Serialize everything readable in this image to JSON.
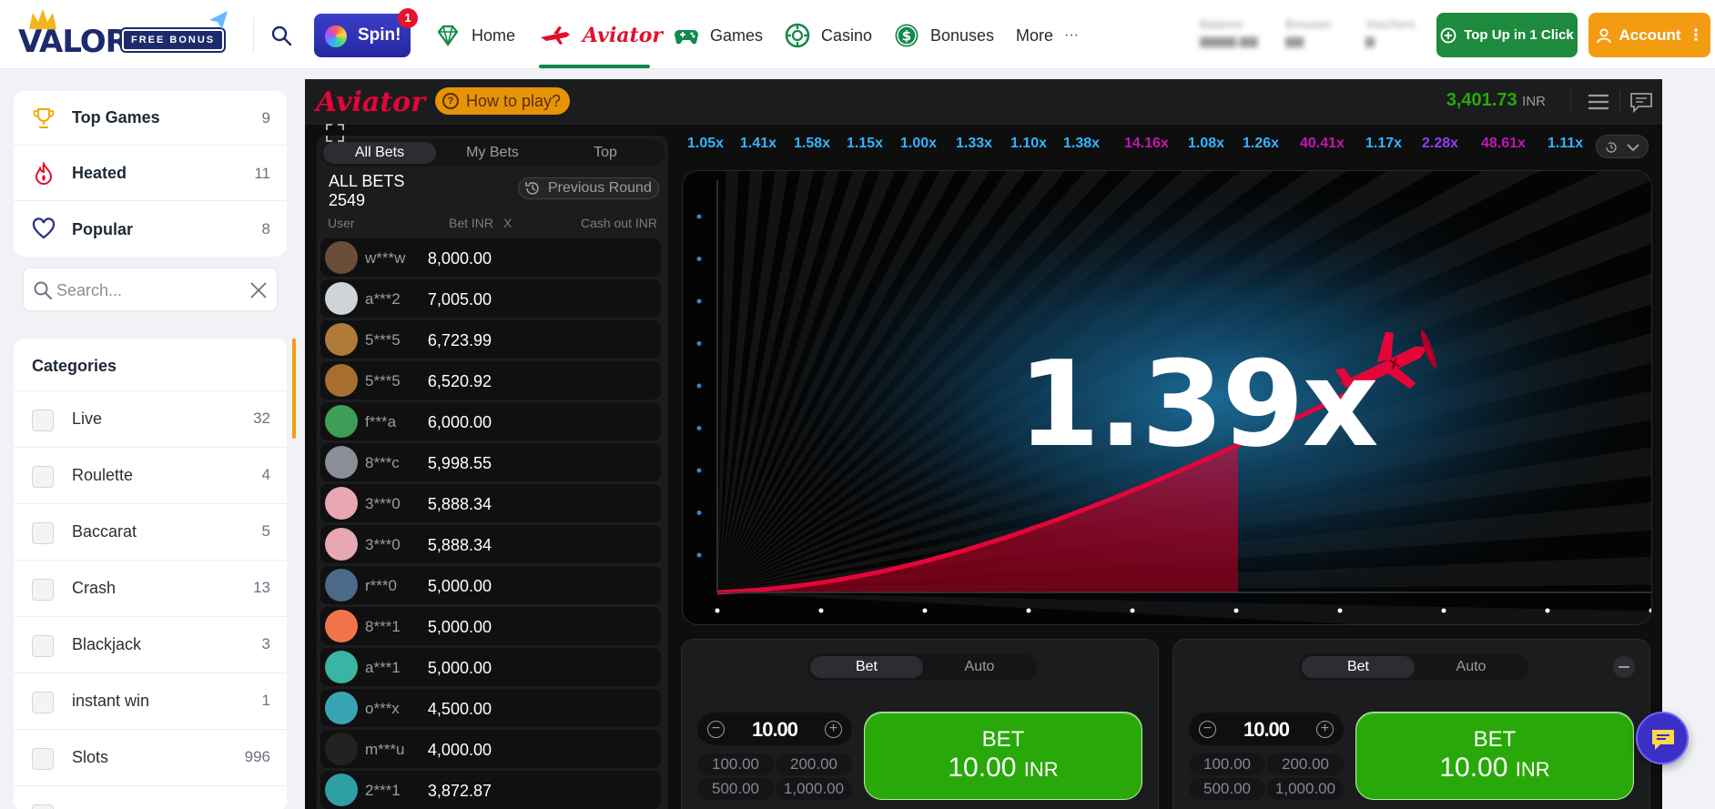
{
  "brand": {
    "logo_text": "VALOR",
    "logo_badge": "FREE BONUS"
  },
  "nav": {
    "spin_label": "Spin!",
    "spin_badge": "1",
    "items": [
      {
        "label": "Home",
        "icon": "diamond-icon"
      },
      {
        "label": "Aviator",
        "icon": "plane-icon"
      },
      {
        "label": "Games",
        "icon": "gamepad-icon"
      },
      {
        "label": "Casino",
        "icon": "chip-icon"
      },
      {
        "label": "Bonuses",
        "icon": "dollar-icon"
      },
      {
        "label": "More",
        "icon": "ellipsis-icon"
      }
    ],
    "more_dots": "···",
    "blurred": [
      "Balance",
      "Bonuses",
      "Vouchers"
    ],
    "topup_label": "Top Up in 1 Click",
    "account_label": "Account",
    "account_dots": "⋮",
    "colors": {
      "active": "#13894a",
      "topup": "#1e8a3e",
      "account": "#f39c12"
    }
  },
  "sidebar": {
    "quick": [
      {
        "label": "Top Games",
        "count": "9",
        "icon": "trophy-icon"
      },
      {
        "label": "Heated",
        "count": "11",
        "icon": "flame-icon"
      },
      {
        "label": "Popular",
        "count": "8",
        "icon": "heart-icon"
      }
    ],
    "search_placeholder": "Search...",
    "categories_title": "Categories",
    "categories": [
      {
        "label": "Live",
        "count": "32"
      },
      {
        "label": "Roulette",
        "count": "4"
      },
      {
        "label": "Baccarat",
        "count": "5"
      },
      {
        "label": "Crash",
        "count": "13"
      },
      {
        "label": "Blackjack",
        "count": "3"
      },
      {
        "label": "instant win",
        "count": "1"
      },
      {
        "label": "Slots",
        "count": "996"
      },
      {
        "label": "",
        "count": ""
      }
    ]
  },
  "game": {
    "logo": "Aviator",
    "how_to_play": "How to play?",
    "balance": "3,401.73",
    "currency": "INR",
    "bets_tabs": [
      "All Bets",
      "My Bets",
      "Top"
    ],
    "all_bets_label": "ALL BETS",
    "all_bets_count": "2549",
    "previous_round": "Previous Round",
    "columns": {
      "user": "User",
      "bet": "Bet INR",
      "x": "X",
      "cashout": "Cash out INR"
    },
    "bets": [
      {
        "user": "w***w",
        "amount": "8,000.00",
        "avatar": "#6b4e3a"
      },
      {
        "user": "a***2",
        "amount": "7,005.00",
        "avatar": "#cfd4d9"
      },
      {
        "user": "5***5",
        "amount": "6,723.99",
        "avatar": "#b07a3b"
      },
      {
        "user": "5***5",
        "amount": "6,520.92",
        "avatar": "#a66f30"
      },
      {
        "user": "f***a",
        "amount": "6,000.00",
        "avatar": "#3c9e57"
      },
      {
        "user": "8***c",
        "amount": "5,998.55",
        "avatar": "#8a8e96"
      },
      {
        "user": "3***0",
        "amount": "5,888.34",
        "avatar": "#e7a7b3"
      },
      {
        "user": "3***0",
        "amount": "5,888.34",
        "avatar": "#e7a7b3"
      },
      {
        "user": "r***0",
        "amount": "5,000.00",
        "avatar": "#4b6a8a"
      },
      {
        "user": "8***1",
        "amount": "5,000.00",
        "avatar": "#f3744b"
      },
      {
        "user": "a***1",
        "amount": "5,000.00",
        "avatar": "#39b6a3"
      },
      {
        "user": "o***x",
        "amount": "4,500.00",
        "avatar": "#3aa4b7"
      },
      {
        "user": "m***u",
        "amount": "4,000.00",
        "avatar": "#222"
      },
      {
        "user": "2***1",
        "amount": "3,872.87",
        "avatar": "#2f9fa6"
      }
    ],
    "history": [
      {
        "v": "1.05x",
        "c": "#34b4ff"
      },
      {
        "v": "1.41x",
        "c": "#34b4ff"
      },
      {
        "v": "1.58x",
        "c": "#34b4ff"
      },
      {
        "v": "1.15x",
        "c": "#34b4ff"
      },
      {
        "v": "1.00x",
        "c": "#34b4ff"
      },
      {
        "v": "1.33x",
        "c": "#34b4ff"
      },
      {
        "v": "1.10x",
        "c": "#34b4ff"
      },
      {
        "v": "1.38x",
        "c": "#34b4ff"
      },
      {
        "v": "14.16x",
        "c": "#c017b4"
      },
      {
        "v": "1.08x",
        "c": "#34b4ff"
      },
      {
        "v": "1.26x",
        "c": "#34b4ff"
      },
      {
        "v": "40.41x",
        "c": "#c017b4"
      },
      {
        "v": "1.17x",
        "c": "#34b4ff"
      },
      {
        "v": "2.28x",
        "c": "#913ef8"
      },
      {
        "v": "48.61x",
        "c": "#c017b4"
      },
      {
        "v": "1.11x",
        "c": "#34b4ff"
      }
    ],
    "multiplier": "1.39x",
    "bet_panels": [
      {
        "tabs": [
          "Bet",
          "Auto"
        ],
        "amount": "10.00",
        "minus": "−",
        "plus": "+",
        "chips": [
          "100.00",
          "200.00",
          "500.00",
          "1,000.00"
        ],
        "btn_title": "BET",
        "btn_amount": "10.00",
        "btn_currency": "INR"
      },
      {
        "tabs": [
          "Bet",
          "Auto"
        ],
        "amount": "10.00",
        "minus": "−",
        "plus": "+",
        "chips": [
          "100.00",
          "200.00",
          "500.00",
          "1,000.00"
        ],
        "btn_title": "BET",
        "btn_amount": "10.00",
        "btn_currency": "INR"
      }
    ],
    "colors": {
      "brand_red": "#e50539",
      "bet_green": "#28a909",
      "balance_green": "#28a909"
    }
  }
}
